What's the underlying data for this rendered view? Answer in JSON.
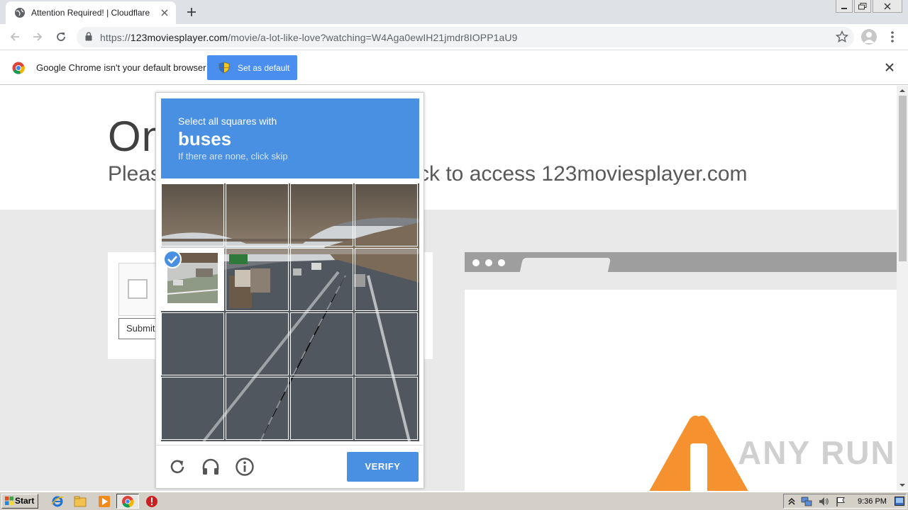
{
  "browser": {
    "tab_title": "Attention Required! | Cloudflare",
    "url_scheme": "https://",
    "url_host": "123moviesplayer.com",
    "url_path": "/movie/a-lot-like-love?watching=W4Aga0ewIH21jmdr8IOPP1aU9"
  },
  "infobar": {
    "message": "Google Chrome isn't your default browser",
    "button_label": "Set as default"
  },
  "page": {
    "headline": "On",
    "subline_start": "Pleas",
    "subline_end": "ck to access 123moviesplayer.com",
    "submit_label": "Submit"
  },
  "captcha": {
    "instruction": "Select all squares with",
    "target": "buses",
    "hint": "If there are none, click skip",
    "selected_tiles": 1,
    "verify_label": "VERIFY"
  },
  "watermark": "ANY RUN",
  "taskbar": {
    "start_label": "Start",
    "clock": "9:36 PM"
  },
  "colors": {
    "captcha_blue": "#4a90e2",
    "warning_orange": "#f5922f",
    "chrome_button": "#4a8ef0"
  }
}
